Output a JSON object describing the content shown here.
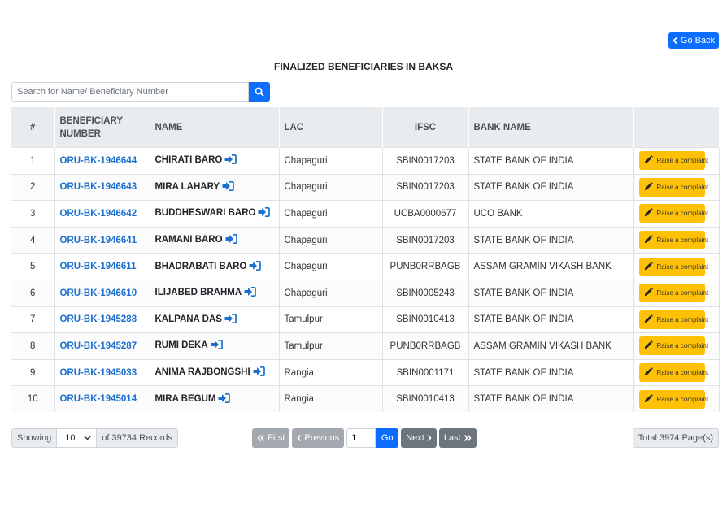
{
  "header": {
    "go_back_label": "Go Back",
    "title": "FINALIZED BENEFICIARIES IN BAKSA"
  },
  "search": {
    "placeholder": "Search for Name/ Beneficiary Number",
    "value": ""
  },
  "table": {
    "columns": [
      "#",
      "BENEFICIARY NUMBER",
      "NAME",
      "LAC",
      "IFSC",
      "BANK NAME",
      ""
    ],
    "action_label": "Raise a complaint",
    "rows": [
      {
        "num": "1",
        "ben": "ORU-BK-1946644",
        "name": "CHIRATI BARO",
        "lac": "Chapaguri",
        "ifsc": "SBIN0017203",
        "bank": "STATE BANK OF INDIA"
      },
      {
        "num": "2",
        "ben": "ORU-BK-1946643",
        "name": "MIRA LAHARY",
        "lac": "Chapaguri",
        "ifsc": "SBIN0017203",
        "bank": "STATE BANK OF INDIA"
      },
      {
        "num": "3",
        "ben": "ORU-BK-1946642",
        "name": "BUDDHESWARI BARO",
        "lac": "Chapaguri",
        "ifsc": "UCBA0000677",
        "bank": "UCO BANK"
      },
      {
        "num": "4",
        "ben": "ORU-BK-1946641",
        "name": "RAMANI BARO",
        "lac": "Chapaguri",
        "ifsc": "SBIN0017203",
        "bank": "STATE BANK OF INDIA"
      },
      {
        "num": "5",
        "ben": "ORU-BK-1946611",
        "name": "BHADRABATI BARO",
        "lac": "Chapaguri",
        "ifsc": "PUNB0RRBAGB",
        "bank": "ASSAM GRAMIN VIKASH BANK"
      },
      {
        "num": "6",
        "ben": "ORU-BK-1946610",
        "name": "ILIJABED BRAHMA",
        "lac": "Chapaguri",
        "ifsc": "SBIN0005243",
        "bank": "STATE BANK OF INDIA"
      },
      {
        "num": "7",
        "ben": "ORU-BK-1945288",
        "name": "KALPANA DAS",
        "lac": "Tamulpur",
        "ifsc": "SBIN0010413",
        "bank": "STATE BANK OF INDIA"
      },
      {
        "num": "8",
        "ben": "ORU-BK-1945287",
        "name": "RUMI DEKA",
        "lac": "Tamulpur",
        "ifsc": "PUNB0RRBAGB",
        "bank": "ASSAM GRAMIN VIKASH BANK"
      },
      {
        "num": "9",
        "ben": "ORU-BK-1945033",
        "name": "ANIMA RAJBONGSHI",
        "lac": "Rangia",
        "ifsc": "SBIN0001171",
        "bank": "STATE BANK OF INDIA"
      },
      {
        "num": "10",
        "ben": "ORU-BK-1945014",
        "name": "MIRA BEGUM",
        "lac": "Rangia",
        "ifsc": "SBIN0010413",
        "bank": "STATE BANK OF INDIA"
      }
    ]
  },
  "footer": {
    "showing_label": "Showing",
    "page_size": "10",
    "records_label": "of 39734 Records",
    "first_label": "First",
    "previous_label": "Previous",
    "page_value": "1",
    "go_label": "Go",
    "next_label": "Next",
    "last_label": "Last",
    "total_label": "Total 3974 Page(s)"
  },
  "colors": {
    "primary": "#0d6efd",
    "warning": "#ffc107",
    "secondary": "#6c757d",
    "link": "#1a6fcf"
  }
}
